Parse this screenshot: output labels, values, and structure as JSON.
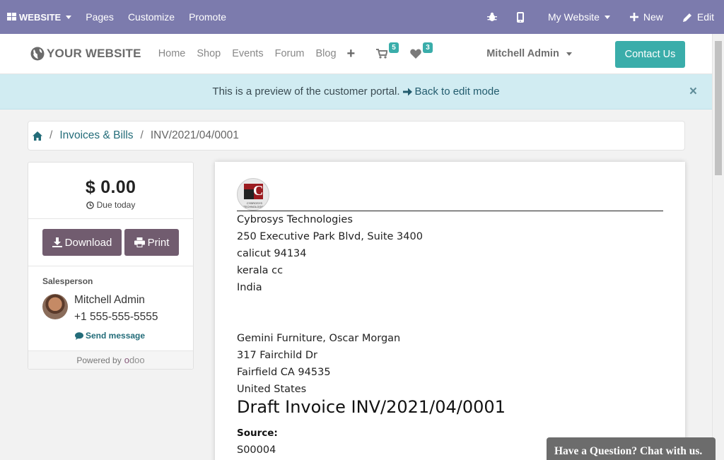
{
  "admin_bar": {
    "website_menu": "WEBSITE",
    "pages": "Pages",
    "customize": "Customize",
    "promote": "Promote",
    "my_website": "My Website",
    "new": "New",
    "edit": "Edit"
  },
  "header": {
    "logo": "YOUR WEBSITE",
    "nav": [
      "Home",
      "Shop",
      "Events",
      "Forum",
      "Blog"
    ],
    "cart_count": "5",
    "wishlist_count": "3",
    "user": "Mitchell Admin",
    "contact": "Contact Us"
  },
  "alert": {
    "text": "This is a preview of the customer portal.",
    "back": "Back to edit mode",
    "close": "×"
  },
  "breadcrumb": {
    "sep": "/",
    "section": "Invoices & Bills",
    "current": "INV/2021/04/0001"
  },
  "sidebar": {
    "amount": "$ 0.00",
    "due": "Due today",
    "download": "Download",
    "print": "Print",
    "salesperson_label": "Salesperson",
    "salesperson_name": "Mitchell Admin",
    "salesperson_phone": "+1 555-555-5555",
    "send_message": "Send message",
    "powered_by": "Powered by",
    "odoo_o": "o",
    "odoo_rest": "doo"
  },
  "invoice": {
    "logo_caption": "CYBROSYS TECHNOLOGIES",
    "company_lines": [
      "Cybrosys Technologies",
      "250 Executive Park Blvd, Suite 3400",
      "calicut 94134",
      "kerala cc",
      "India"
    ],
    "customer_lines": [
      "Gemini Furniture, Oscar Morgan",
      "317 Fairchild Dr",
      "Fairfield CA 94535",
      "United States"
    ],
    "title": "Draft Invoice INV/2021/04/0001",
    "source_label": "Source:",
    "source_value": "S00004"
  },
  "chat": {
    "text": "Have a Question? Chat with us."
  },
  "colors": {
    "admin_bar": "#7c7bad",
    "accent": "#3aadaa",
    "button": "#715c6f",
    "alert_bg": "#d1ecf2"
  }
}
